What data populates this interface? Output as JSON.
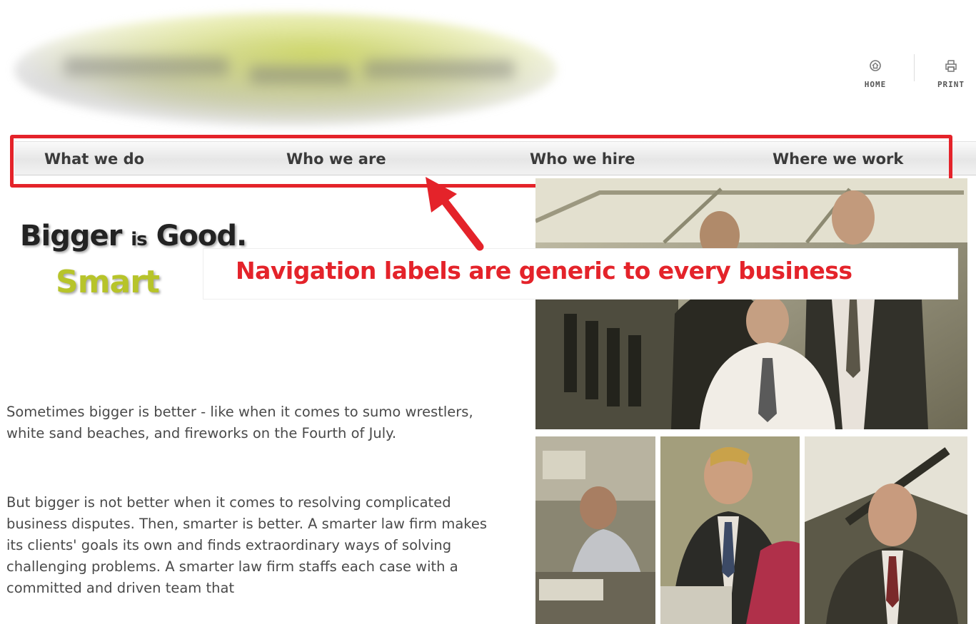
{
  "header": {
    "utility_links": [
      {
        "label": "HOME",
        "icon": "home-icon"
      },
      {
        "label": "PRINT",
        "icon": "print-icon"
      }
    ]
  },
  "nav": {
    "items": [
      {
        "label": "What we do"
      },
      {
        "label": "Who we are"
      },
      {
        "label": "Who we hire"
      },
      {
        "label": "Where we work"
      }
    ]
  },
  "hero": {
    "line1_word1": "Bigger",
    "line1_word2": "is",
    "line1_word3": "Good.",
    "line2_partial": "Smart"
  },
  "annotation": {
    "callout": "Navigation labels are generic to every business",
    "color": "#e4232a"
  },
  "body": {
    "paragraph1": "Sometimes bigger is better - like when it comes to sumo wrestlers, white sand beaches, and fireworks on the Fourth of July.",
    "paragraph2": "But bigger is not better when it comes to resolving complicated business disputes. Then, smarter is better. A smarter law firm makes its clients' goals its own and finds extraordinary ways of solving challenging problems. A smarter law firm staffs each case with a committed and driven team that"
  },
  "colors": {
    "accent_green": "#b7c42a",
    "highlight_red": "#e4232a",
    "nav_text": "#3a3a3a"
  }
}
